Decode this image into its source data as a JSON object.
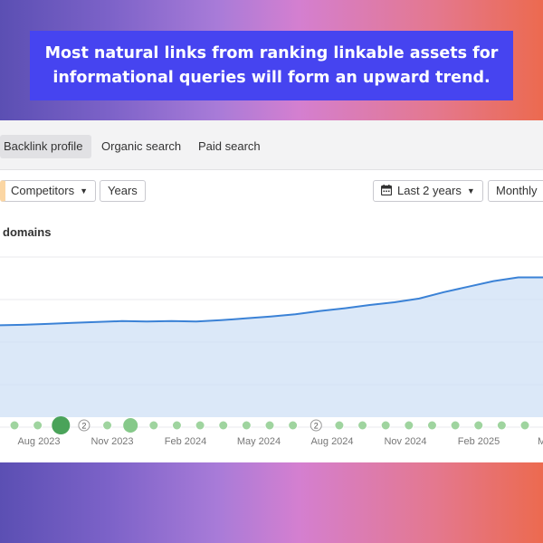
{
  "banner": {
    "line1": "Most natural links from ranking linkable assets for",
    "line2": "informational queries will form an upward trend."
  },
  "tabs": [
    {
      "label": "Backlink profile",
      "active": true
    },
    {
      "label": "Organic search",
      "active": false
    },
    {
      "label": "Paid search",
      "active": false
    }
  ],
  "toolbar": {
    "competitors_label": "Competitors",
    "years_label": "Years",
    "range_label": "Last 2 years",
    "interval_label": "Monthly"
  },
  "chart_title": "domains",
  "chart_data": {
    "type": "area",
    "x_labels": [
      "Aug 2023",
      "Nov 2023",
      "Feb 2024",
      "May 2024",
      "Aug 2024",
      "Nov 2024",
      "Feb 2025",
      "Ma"
    ],
    "values": [
      100,
      100.5,
      101.5,
      102.5,
      103.5,
      104.5,
      104,
      104.5,
      104,
      105.5,
      107.5,
      109.5,
      112,
      115.5,
      118.5,
      122,
      125,
      129,
      136,
      142,
      148,
      152,
      152
    ],
    "ylim": [
      0,
      185
    ],
    "grid": true,
    "event_markers": [
      {
        "kind": "small"
      },
      {
        "kind": "small"
      },
      {
        "kind": "large"
      },
      {
        "kind": "count",
        "label": "2"
      },
      {
        "kind": "small"
      },
      {
        "kind": "large"
      },
      {
        "kind": "small"
      },
      {
        "kind": "small"
      },
      {
        "kind": "small"
      },
      {
        "kind": "small"
      },
      {
        "kind": "small"
      },
      {
        "kind": "small"
      },
      {
        "kind": "small"
      },
      {
        "kind": "count",
        "label": "2"
      },
      {
        "kind": "small"
      },
      {
        "kind": "small"
      },
      {
        "kind": "small"
      },
      {
        "kind": "small"
      },
      {
        "kind": "small"
      },
      {
        "kind": "small"
      },
      {
        "kind": "small"
      },
      {
        "kind": "small"
      },
      {
        "kind": "small"
      }
    ],
    "line_color": "#3b82d6",
    "fill_color": "#cfe0f5",
    "marker_color": "#9fd49f"
  }
}
